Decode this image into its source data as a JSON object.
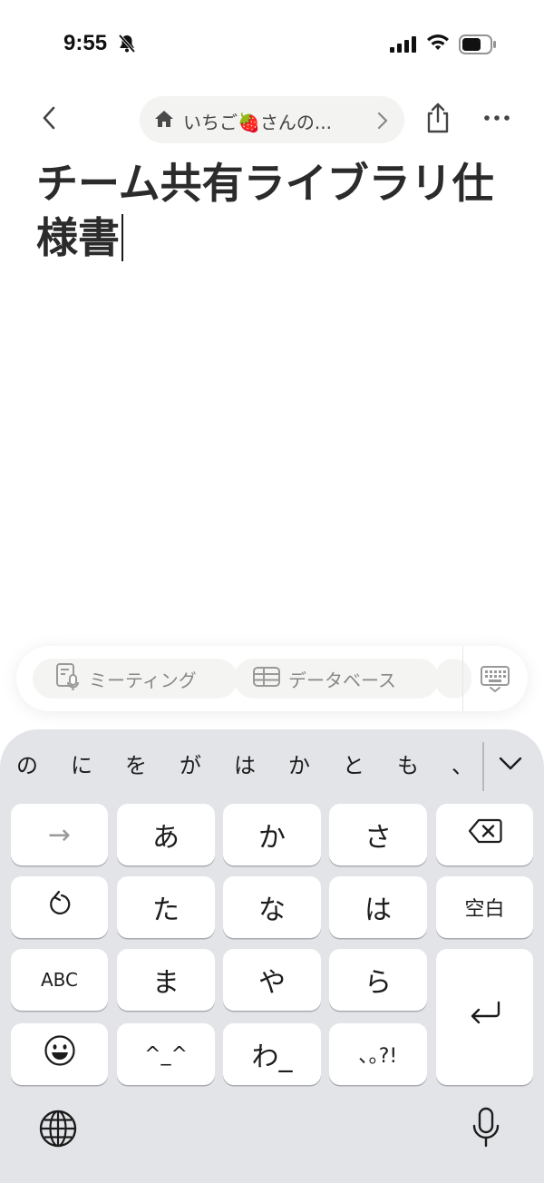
{
  "status": {
    "time": "9:55"
  },
  "nav": {
    "breadcrumb_text": "いちご🍓さんの..."
  },
  "page": {
    "title": "チーム共有ライブラリ仕様書"
  },
  "toolbar": {
    "chips": [
      {
        "label": "ミーティング",
        "icon": "meeting-notes-icon"
      },
      {
        "label": "データベース",
        "icon": "table-icon"
      }
    ]
  },
  "keyboard": {
    "suggestions": [
      "の",
      "に",
      "を",
      "が",
      "は",
      "か",
      "と",
      "も",
      "、"
    ],
    "keys": {
      "next": "→",
      "a": "あ",
      "ka": "か",
      "sa": "さ",
      "ta": "た",
      "na": "な",
      "ha": "は",
      "space": "空白",
      "abc": "ABC",
      "ma": "ま",
      "ya": "や",
      "ra": "ら",
      "kaomoji": "^_^",
      "wa": "わ_",
      "punct": "､｡?!"
    }
  }
}
